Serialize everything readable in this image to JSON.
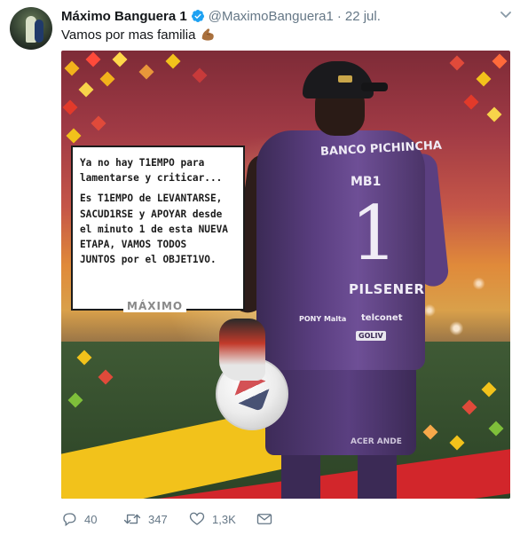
{
  "tweet": {
    "author_name": "Máximo Banguera 1",
    "handle": "@MaximoBanguera1",
    "separator": "·",
    "time": "22 jul.",
    "text": "Vamos por mas familia",
    "emoji": "flexed-biceps-emoji"
  },
  "media": {
    "quote_lines": [
      "Ya no hay T1EMPO para",
      "lamentarse y criticar...",
      "",
      "Es T1EMPO de LEVANTARSE,",
      "SACUD1RSE y APOYAR desde",
      "el minuto 1 de esta NUEVA",
      "ETAPA, VAMOS TODOS",
      "JUNTOS por el OBJET1VO."
    ],
    "signature": "MÁXIMO",
    "shirt": {
      "bank": "BANCO PICHINCHA",
      "initials": "MB1",
      "number": "1",
      "sponsor": "PILSENER",
      "sponsor2": "telconet",
      "sponsor3": "PONY Malta",
      "sponsor4": "GOLIV",
      "sponsor5": "ACER ANDE"
    },
    "colors": {
      "yellow": "#f2c21b",
      "red": "#d2262b",
      "jersey": "#5a3e80"
    }
  },
  "actions": {
    "reply_count": "40",
    "retweet_count": "347",
    "like_count": "1,3K"
  },
  "icons": {
    "verified": "verified-badge-icon",
    "more": "chevron-down-icon",
    "reply": "reply-icon",
    "retweet": "retweet-icon",
    "like": "heart-icon",
    "dm": "envelope-icon"
  }
}
